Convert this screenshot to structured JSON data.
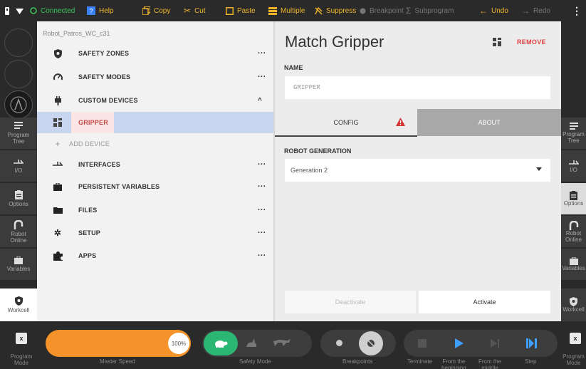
{
  "topbar": {
    "connected": "Connected",
    "help": "Help",
    "copy": "Copy",
    "cut": "Cut",
    "paste": "Paste",
    "multiple": "Multiple",
    "suppress": "Suppress",
    "breakpoint": "Breakpoint",
    "subprogram": "Subprogram",
    "undo": "Undo",
    "redo": "Redo"
  },
  "leftnav": {
    "items": [
      {
        "label": "Program\nTree",
        "icon": "program-tree-icon"
      },
      {
        "label": "I/O",
        "icon": "io-icon"
      },
      {
        "label": "Options",
        "icon": "clipboard-icon"
      },
      {
        "label": "Robot\nOnline",
        "icon": "robot-arm-icon"
      },
      {
        "label": "Variables",
        "icon": "briefcase-icon"
      },
      {
        "label": "Workcell",
        "icon": "shield-icon"
      }
    ]
  },
  "rightnav": {
    "items": [
      {
        "label": "Program\nTree",
        "icon": "program-tree-icon"
      },
      {
        "label": "I/O",
        "icon": "io-icon"
      },
      {
        "label": "Options",
        "icon": "clipboard-icon"
      },
      {
        "label": "Robot\nOnline",
        "icon": "robot-arm-icon"
      },
      {
        "label": "Variables",
        "icon": "briefcase-icon"
      },
      {
        "label": "Workcell",
        "icon": "shield-icon"
      }
    ]
  },
  "tree": {
    "filename": "Robot_Patros_WC_c31",
    "items": [
      {
        "label": "SAFETY ZONES",
        "icon": "shield-icon"
      },
      {
        "label": "SAFETY MODES",
        "icon": "gauge-icon"
      },
      {
        "label": "CUSTOM DEVICES",
        "icon": "plug-icon"
      },
      {
        "label": "GRIPPER",
        "icon": "layout-icon"
      },
      {
        "label": "ADD DEVICE",
        "icon": "plus-icon"
      },
      {
        "label": "INTERFACES",
        "icon": "io-icon"
      },
      {
        "label": "PERSISTENT VARIABLES",
        "icon": "briefcase-icon"
      },
      {
        "label": "FILES",
        "icon": "folder-icon"
      },
      {
        "label": "SETUP",
        "icon": "gear-icon"
      },
      {
        "label": "APPS",
        "icon": "puzzle-icon"
      }
    ]
  },
  "detail": {
    "title": "Match Gripper",
    "remove": "REMOVE",
    "name_label": "NAME",
    "name_value": "GRIPPER",
    "tab_config": "CONFIG",
    "tab_about": "ABOUT",
    "generation_label": "ROBOT GENERATION",
    "generation_value": "Generation 2",
    "deactivate": "Deactivate",
    "activate": "Activate"
  },
  "bottombar": {
    "program_mode": "Program\nMode",
    "speed_value": "100%",
    "speed_fraction": 1.0,
    "master_speed": "Master Speed",
    "safety_mode": "Safety Mode",
    "breakpoints": "Breakpoints",
    "terminate": "Terminate",
    "from_beginning": "From the\nbeginning",
    "from_middle": "From the\nmiddle",
    "step": "Step"
  },
  "colors": {
    "accent": "#f0b429",
    "speed": "#f5922a",
    "safety": "#2bb673",
    "remove": "#e04040",
    "selected_row": "#c9d5ef",
    "play": "#3f9fff"
  }
}
